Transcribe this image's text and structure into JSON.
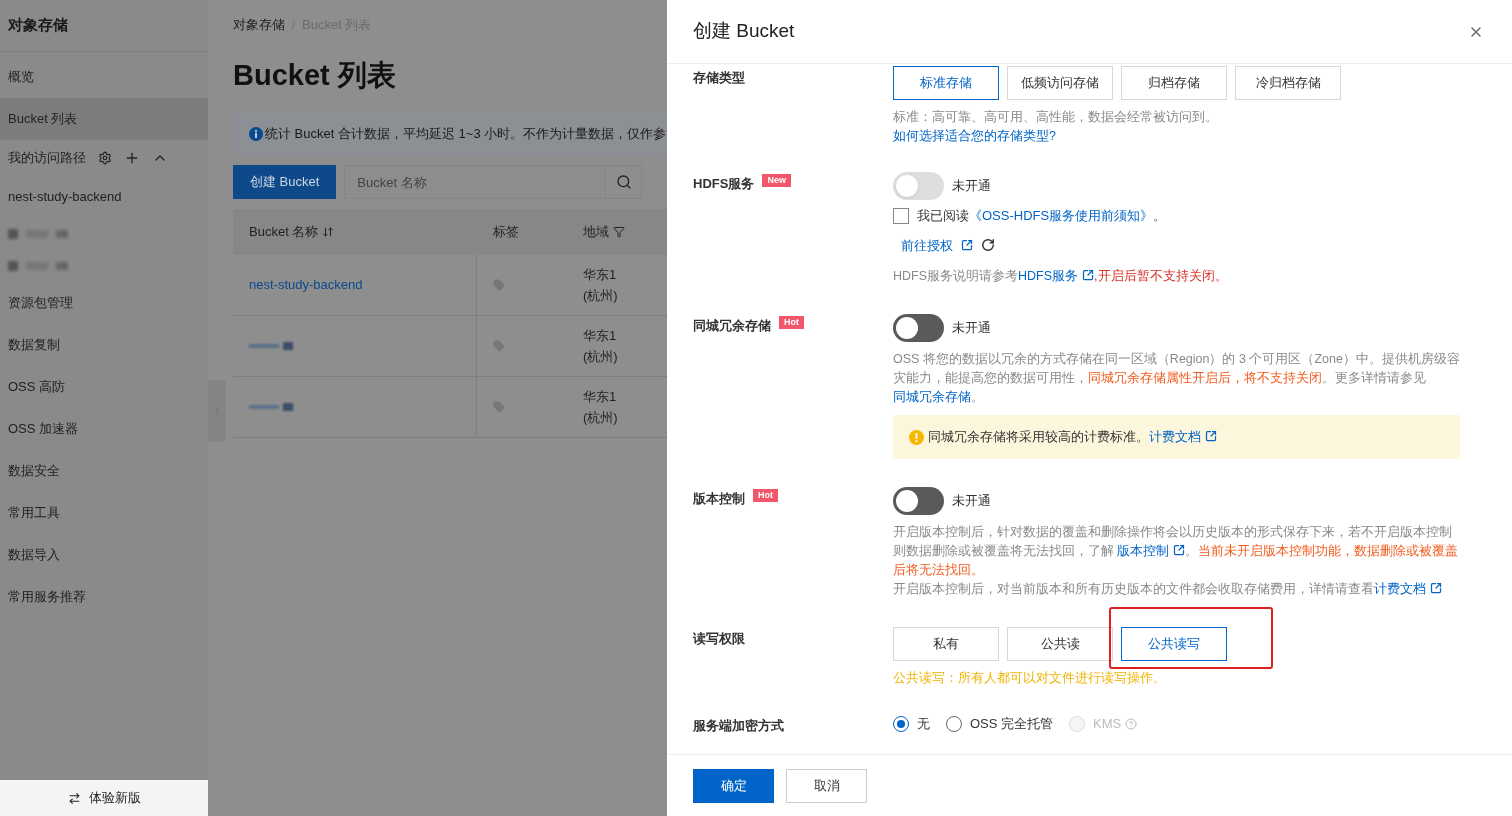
{
  "sidebar": {
    "title": "对象存储",
    "items": [
      {
        "kind": "item",
        "label": "概览",
        "selected": false
      },
      {
        "kind": "item",
        "label": "Bucket 列表",
        "selected": true
      },
      {
        "kind": "section",
        "label": "我的访问路径",
        "expanded": true
      },
      {
        "kind": "item",
        "label": "nest-study-backend",
        "selected": false
      },
      {
        "kind": "redacted"
      },
      {
        "kind": "redacted"
      },
      {
        "kind": "item",
        "label": "资源包管理",
        "selected": false
      },
      {
        "kind": "item",
        "label": "数据复制",
        "selected": false
      },
      {
        "kind": "item",
        "label": "OSS 高防",
        "selected": false
      },
      {
        "kind": "item",
        "label": "OSS 加速器",
        "selected": false
      },
      {
        "kind": "item",
        "label": "数据安全",
        "selected": false
      },
      {
        "kind": "item",
        "label": "常用工具",
        "selected": false
      },
      {
        "kind": "item",
        "label": "数据导入",
        "selected": false
      },
      {
        "kind": "item",
        "label": "常用服务推荐",
        "selected": false
      }
    ],
    "footer_button": "体验新版"
  },
  "main": {
    "breadcrumb": [
      "对象存储",
      "Bucket 列表"
    ],
    "title": "Bucket 列表",
    "notice": "统计 Bucket 合计数据，平均延迟 1~3 小时。不作为计量数据，仅作参",
    "create_button": "创建 Bucket",
    "search": {
      "placeholder": "Bucket 名称"
    },
    "table": {
      "columns": [
        {
          "label": "Bucket 名称",
          "kind": "sort"
        },
        {
          "label": "标签",
          "kind": "plain"
        },
        {
          "label": "地域",
          "kind": "filter"
        }
      ],
      "rows": [
        {
          "name": "nest-study-backend",
          "redacted": false,
          "region": [
            "华东1",
            "(杭州)"
          ]
        },
        {
          "redacted": true,
          "region": [
            "华东1",
            "(杭州)"
          ]
        },
        {
          "redacted": true,
          "region": [
            "华东1",
            "(杭州)"
          ]
        }
      ]
    }
  },
  "drawer": {
    "title": "创建 Bucket",
    "fields": [
      {
        "kind": "options",
        "label": "存储类型",
        "options": [
          {
            "label": "标准存储",
            "selected": true,
            "highlighted": false
          },
          {
            "label": "低频访问存储",
            "selected": false,
            "highlighted": false
          },
          {
            "label": "归档存储",
            "selected": false,
            "highlighted": false
          },
          {
            "label": "冷归档存储",
            "selected": false,
            "highlighted": false
          }
        ],
        "notes": [
          [
            {
              "kind": "text",
              "text": "标准：高可靠、高可用、高性能，数据会经常被访问到。"
            }
          ],
          [
            {
              "kind": "link",
              "text": "如何选择适合您的存储类型?",
              "external": false
            }
          ]
        ]
      },
      {
        "kind": "toggle",
        "label": "HDFS服务",
        "badge": "New",
        "on": false,
        "disabled": true,
        "status": "未开通",
        "checkbox": {
          "checked": false,
          "segments": [
            {
              "kind": "text",
              "text": "我已阅读"
            },
            {
              "kind": "link",
              "text": "《OSS-HDFS服务使用前须知》",
              "external": false
            },
            {
              "kind": "text",
              "text": "。"
            }
          ]
        },
        "action_link": "前往授权",
        "notes": [
          [
            {
              "kind": "text",
              "text": "HDFS服务说明请参考"
            },
            {
              "kind": "link",
              "text": "HDFS服务",
              "external": true
            },
            {
              "kind": "danger",
              "text": ",开启后暂不支持关闭。"
            }
          ]
        ]
      },
      {
        "kind": "toggle",
        "label": "同城冗余存储",
        "badge": "Hot",
        "on": false,
        "disabled": false,
        "status": "未开通",
        "notes": [
          [
            {
              "kind": "text",
              "text": "OSS 将您的数据以冗余的方式存储在同一区域（Region）的 3 个可用区（Zone）中。提供机房级容灾能力，能提高您的数据可用性，"
            },
            {
              "kind": "caution",
              "text": "同城冗余存储属性开启后，将不支持关闭"
            },
            {
              "kind": "text",
              "text": "。更多详情请参见 "
            },
            {
              "kind": "link",
              "text": "同城冗余存储",
              "external": false
            },
            {
              "kind": "text",
              "text": "。"
            }
          ]
        ],
        "alert": [
          {
            "kind": "plain",
            "text": "同城冗余存储将采用较高的计费标准。"
          },
          {
            "kind": "link",
            "text": "计费文档",
            "external": true
          }
        ]
      },
      {
        "kind": "toggle",
        "label": "版本控制",
        "badge": "Hot",
        "on": false,
        "disabled": false,
        "status": "未开通",
        "notes": [
          [
            {
              "kind": "text",
              "text": "开启版本控制后，针对数据的覆盖和删除操作将会以历史版本的形式保存下来，若不开启版本控制则数据删除或被覆盖将无法找回，了解 "
            },
            {
              "kind": "link",
              "text": "版本控制",
              "external": true
            },
            {
              "kind": "text",
              "text": "。"
            },
            {
              "kind": "caution",
              "text": "当前未开启版本控制功能，数据删除或被覆盖后将无法找回。"
            }
          ],
          [
            {
              "kind": "text",
              "text": "开启版本控制后，对当前版本和所有历史版本的文件都会收取存储费用，详情请查看"
            },
            {
              "kind": "link",
              "text": "计费文档",
              "external": true
            }
          ]
        ]
      },
      {
        "kind": "options",
        "label": "读写权限",
        "options": [
          {
            "label": "私有",
            "selected": false,
            "highlighted": false
          },
          {
            "label": "公共读",
            "selected": false,
            "highlighted": false
          },
          {
            "label": "公共读写",
            "selected": true,
            "highlighted": true
          }
        ],
        "notes": [
          [
            {
              "kind": "notice",
              "text": "公共读写：所有人都可以对文件进行读写操作。"
            }
          ]
        ]
      },
      {
        "kind": "radio",
        "label": "服务端加密方式",
        "options": [
          {
            "label": "无",
            "selected": true,
            "disabled": false,
            "help": false
          },
          {
            "label": "OSS 完全托管",
            "selected": false,
            "disabled": false,
            "help": false
          },
          {
            "label": "KMS",
            "selected": false,
            "disabled": true,
            "help": true
          }
        ]
      }
    ],
    "buttons": [
      {
        "label": "确定",
        "kind": "primary"
      },
      {
        "label": "取消",
        "kind": "default"
      }
    ]
  }
}
